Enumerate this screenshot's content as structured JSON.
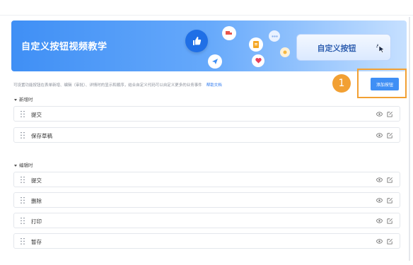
{
  "banner": {
    "title": "自定义按钮视频教学",
    "demo_button": "自定义按钮"
  },
  "description": {
    "text": "可设置功能按钮在表单新增、编辑（审批）、详情时的显示和顺序，结合自定义代码可以自定义更多的业务事件",
    "help_link": "帮助文档"
  },
  "add_button": {
    "label": "添加按钮",
    "step_number": "1"
  },
  "sections": {
    "create": {
      "label": "新增时",
      "items": [
        {
          "label": "提交"
        },
        {
          "label": "保存草稿"
        }
      ]
    },
    "edit": {
      "label": "编辑时",
      "items": [
        {
          "label": "提交"
        },
        {
          "label": "删除"
        },
        {
          "label": "打印"
        },
        {
          "label": "暂存"
        }
      ]
    }
  },
  "colors": {
    "accent": "#3f8ff5",
    "highlight": "#f2a033"
  }
}
